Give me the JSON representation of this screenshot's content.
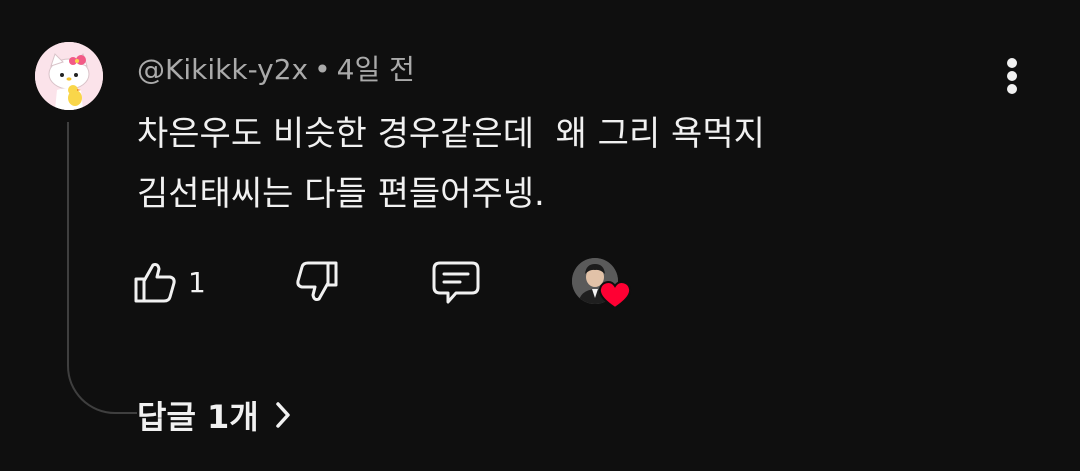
{
  "comment": {
    "author_avatar_icon": "hello-kitty-avatar-icon",
    "author": "@Kikikk-y2x",
    "separator": "•",
    "timestamp": "4일 전",
    "body_lines": [
      "차은우도 비슷한 경우같은데  왜 그리 욕먹지",
      "김선태씨는 다들 편들어주넹."
    ],
    "like_count": "1",
    "creator_heart_icon": "heart-icon",
    "replies_label": "답글 1개"
  },
  "colors": {
    "background": "#0f0f0f",
    "text_primary": "#f1f1f1",
    "text_secondary": "#aaaaaa",
    "heart_red": "#ff0033",
    "thread_line": "#3f3f3f"
  }
}
